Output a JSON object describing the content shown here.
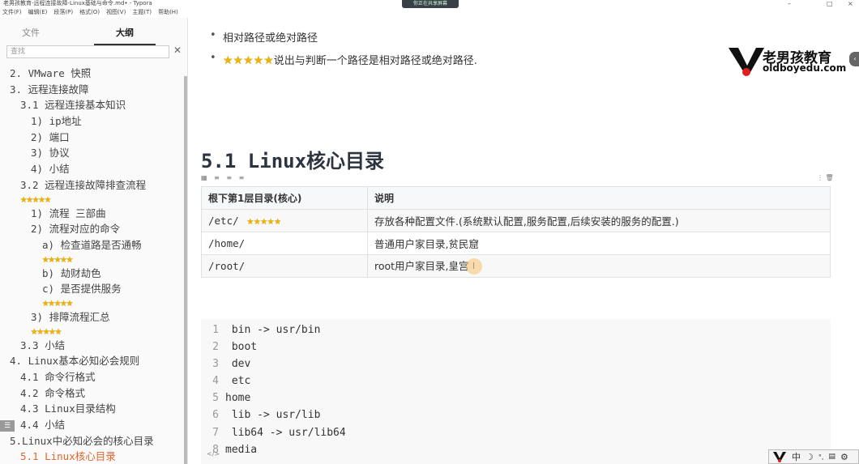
{
  "window": {
    "title": "老男孩教育-远程连接故障-Linux基础与命令.md• - Typora",
    "share_badge": "你正在共享屏幕",
    "controls": [
      "–",
      "□",
      "×"
    ]
  },
  "menu": [
    "文件(F)",
    "编辑(E)",
    "段落(P)",
    "格式(O)",
    "视图(V)",
    "主题(T)",
    "帮助(H)"
  ],
  "sidebar": {
    "tabs": [
      {
        "label": "文件",
        "active": false
      },
      {
        "label": "大纲",
        "active": true
      }
    ],
    "search_placeholder": "查找",
    "outline": [
      {
        "text": "2. VMware 快照",
        "level": 0
      },
      {
        "text": "3. 远程连接故障",
        "level": 0
      },
      {
        "text": "3.1 远程连接基本知识",
        "level": 1
      },
      {
        "text": "1) ip地址",
        "level": 2
      },
      {
        "text": "2) 端口",
        "level": 2
      },
      {
        "text": "3) 协议",
        "level": 2
      },
      {
        "text": "4) 小结",
        "level": 2
      },
      {
        "text": "3.2 远程连接故障排查流程",
        "level": 1,
        "stars": 5
      },
      {
        "text": "1) 流程 三部曲",
        "level": 2
      },
      {
        "text": "2) 流程对应的命令",
        "level": 2
      },
      {
        "text": "a) 检查道路是否通畅",
        "level": 3,
        "stars": 5
      },
      {
        "text": "b) 劫财劫色",
        "level": 3
      },
      {
        "text": "c) 是否提供服务",
        "level": 3,
        "stars": 5
      },
      {
        "text": "3) 排障流程汇总",
        "level": 2,
        "stars": 5
      },
      {
        "text": "3.3 小结",
        "level": 1
      },
      {
        "text": "4. Linux基本必知必会规则",
        "level": 0
      },
      {
        "text": "4.1 命令行格式",
        "level": 1
      },
      {
        "text": "4.2 命令格式",
        "level": 1
      },
      {
        "text": "4.3 Linux目录结构",
        "level": 1
      },
      {
        "text": "4.4 小结",
        "level": 1
      },
      {
        "text": "5.Linux中必知必会的核心目录",
        "level": 0
      },
      {
        "text": "5.1 Linux核心目录",
        "level": 1,
        "active": true
      }
    ]
  },
  "doc": {
    "bullets": [
      {
        "text": "相对路径或绝对路径",
        "stars": 0
      },
      {
        "text": "说出与判断一个路径是相对路径或绝对路径.",
        "stars": 5
      }
    ],
    "logo": {
      "cn": "老男孩教育",
      "en": "oldboyedu.com"
    },
    "heading": "5.1 Linux核心目录",
    "table": {
      "headers": [
        "根下第1层目录(核心)",
        "说明"
      ],
      "rows": [
        {
          "dir": "/etc/",
          "stars": 5,
          "desc": "存放各种配置文件.(系统默认配置,服务配置,后续安装的服务的配置.)"
        },
        {
          "dir": "/home/",
          "stars": 0,
          "desc": "普通用户家目录,贫民窟"
        },
        {
          "dir": "/root/",
          "stars": 0,
          "desc": "root用户家目录,皇宫"
        }
      ]
    },
    "code": [
      " bin -> usr/bin",
      " boot",
      " dev",
      " etc",
      "home",
      " lib -> usr/lib",
      " lib64 -> usr/lib64",
      "media"
    ]
  },
  "ime": {
    "lang": "中"
  },
  "colors": {
    "accent": "#e0662a",
    "star": "#f0b400"
  }
}
